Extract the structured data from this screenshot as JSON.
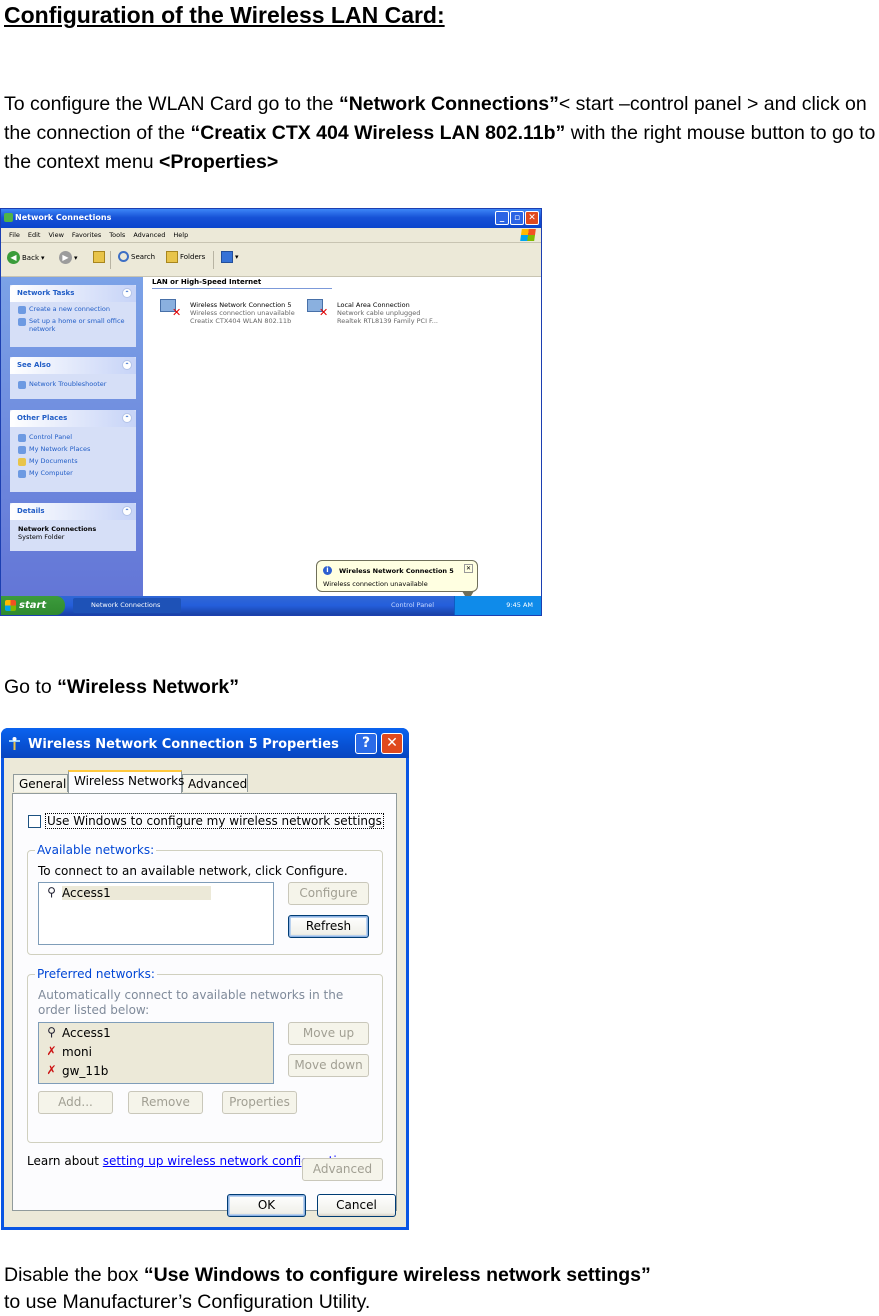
{
  "doc": {
    "title": "Configuration of the Wireless LAN Card:",
    "p1": {
      "a": "To configure the WLAN Card go to the ",
      "b": "“Network Connections”",
      "c": "< start –control panel > and click on the connection of the ",
      "d": "“Creatix CTX 404 Wireless LAN 802.11b”",
      "e": " with the right mouse button to go to the context menu ",
      "f": "<Properties>"
    },
    "p2": {
      "a": "Go to ",
      "b": "“Wireless Network”"
    },
    "p3": {
      "a": "Disable the box ",
      "b": "“Use Windows to configure wireless network settings”",
      "c": "to use Manufacturer’s Configuration Utility."
    }
  },
  "netconn": {
    "title": "Network Connections",
    "menu": [
      "File",
      "Edit",
      "View",
      "Favorites",
      "Tools",
      "Advanced",
      "Help"
    ],
    "toolbar": {
      "back": "Back",
      "search": "Search",
      "folders": "Folders"
    },
    "panels": {
      "tasks": {
        "title": "Network Tasks",
        "items": [
          "Create a new connection",
          "Set up a home or small office network"
        ]
      },
      "see_also": {
        "title": "See Also",
        "items": [
          "Network Troubleshooter"
        ]
      },
      "other": {
        "title": "Other Places",
        "items": [
          "Control Panel",
          "My Network Places",
          "My Documents",
          "My Computer"
        ]
      },
      "details": {
        "title": "Details",
        "name": "Network Connections",
        "type": "System Folder"
      }
    },
    "group_label": "LAN or High-Speed Internet",
    "connections": [
      {
        "name": "Wireless Network Connection 5",
        "status": "Wireless connection unavailable",
        "device": "Creatix CTX404 WLAN 802.11b"
      },
      {
        "name": "Local Area Connection",
        "status": "Network cable unplugged",
        "device": "Realtek RTL8139 Family PCI F..."
      }
    ],
    "balloon": {
      "title": "Wireless Network Connection 5",
      "message": "Wireless connection unavailable"
    },
    "taskbar": {
      "start": "start",
      "task": "Network Connections",
      "control_panel": "Control Panel",
      "clock": "9:45 AM"
    }
  },
  "props": {
    "title": "Wireless Network Connection 5 Properties",
    "tabs": [
      "General",
      "Wireless Networks",
      "Advanced"
    ],
    "use_windows_label": "Use Windows to configure my wireless network settings",
    "available": {
      "legend": "Available networks:",
      "hint": "To connect to an available network, click Configure.",
      "networks": [
        "Access1"
      ],
      "configure": "Configure",
      "refresh": "Refresh"
    },
    "preferred": {
      "legend": "Preferred networks:",
      "hint": "Automatically connect to available networks in the order listed below:",
      "networks": [
        "Access1",
        "moni",
        "gw_11b"
      ],
      "move_up": "Move up",
      "move_down": "Move down",
      "add": "Add...",
      "remove": "Remove",
      "properties": "Properties"
    },
    "learn_prefix": "Learn about ",
    "learn_link": "setting up wireless network configuration.",
    "advanced_button": "Advanced",
    "ok": "OK",
    "cancel": "Cancel"
  }
}
